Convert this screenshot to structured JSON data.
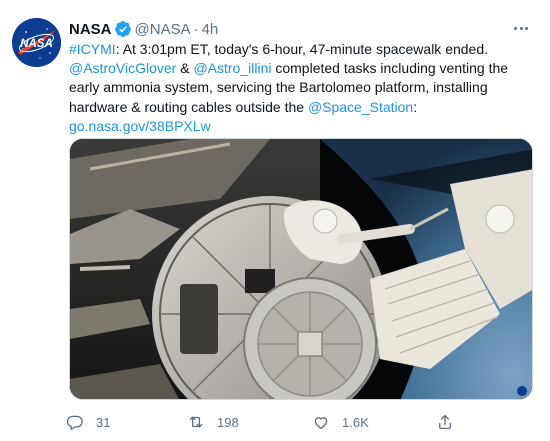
{
  "tweet": {
    "author_name": "NASA",
    "handle": "@NASA",
    "separator": "·",
    "time": "4h",
    "text": {
      "hashtag": "#ICYMI",
      "part1": ": At 3:01pm ET, today's 6-hour, 47-minute spacewalk ended.",
      "mention1": "@AstroVicGlover",
      "amp": " & ",
      "mention2": "@Astro_illini",
      "part2": " completed tasks including venting the early ammonia system, servicing the Bartolomeo platform, installing hardware & routing cables outside the ",
      "mention3": "@Space_Station",
      "part3": ":",
      "link": "go.nasa.gov/38BPXLw"
    },
    "avatar_text": "NASA",
    "media_watermark": "NASA",
    "actions": {
      "replies": "31",
      "retweets": "198",
      "likes": "1.6K"
    }
  },
  "colors": {
    "link": "#1b95e0",
    "verified": "#1da1f2",
    "muted": "#5b7083",
    "text": "#0f1419"
  },
  "icons": [
    "verified-badge-icon",
    "more-icon",
    "reply-icon",
    "retweet-icon",
    "like-icon",
    "share-icon"
  ]
}
